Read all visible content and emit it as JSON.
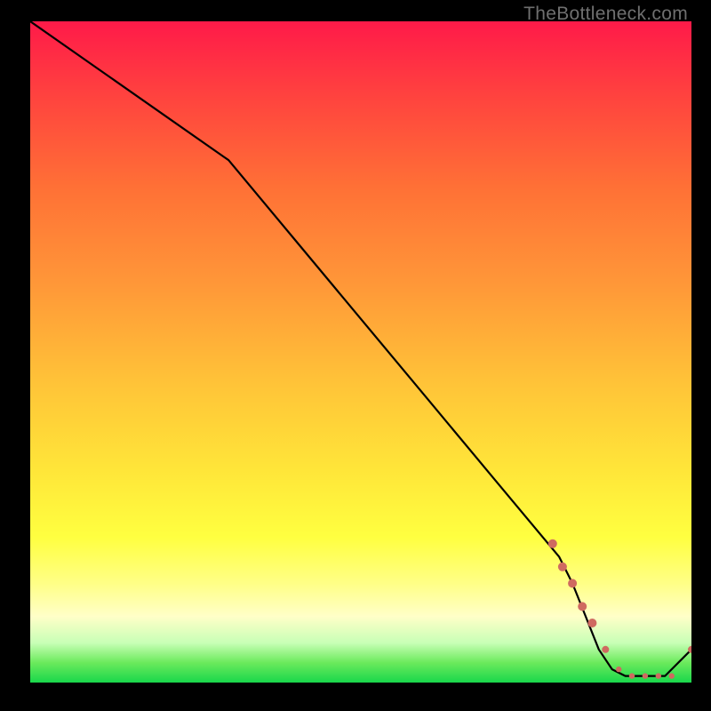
{
  "watermark": "TheBottleneck.com",
  "colors": {
    "background": "#000000",
    "line": "#000000",
    "marker": "#cf6a60",
    "gradient_top": "#ff1a49",
    "gradient_bottom": "#19d74b"
  },
  "chart_data": {
    "type": "line",
    "title": "",
    "xlabel": "",
    "ylabel": "",
    "xlim": [
      0,
      100
    ],
    "ylim": [
      0,
      100
    ],
    "series": [
      {
        "name": "bottleneck-curve",
        "x": [
          0,
          10,
          20,
          30,
          40,
          50,
          60,
          70,
          80,
          82,
          84,
          86,
          88,
          90,
          92,
          94,
          96,
          100
        ],
        "y": [
          100,
          93,
          86,
          79,
          67,
          55,
          43,
          31,
          19,
          15,
          10,
          5,
          2,
          1,
          1,
          1,
          1,
          5
        ]
      }
    ],
    "markers": {
      "name": "highlighted-region",
      "x": [
        79,
        80.5,
        82,
        83.5,
        85,
        87,
        89,
        91,
        93,
        95,
        97,
        100
      ],
      "y": [
        21,
        17.5,
        15,
        11.5,
        9,
        5,
        2,
        1,
        1,
        1,
        1,
        5
      ],
      "size": [
        5,
        5,
        5,
        5,
        5,
        4,
        3.2,
        3.2,
        3.2,
        3.2,
        3.2,
        4
      ]
    }
  }
}
